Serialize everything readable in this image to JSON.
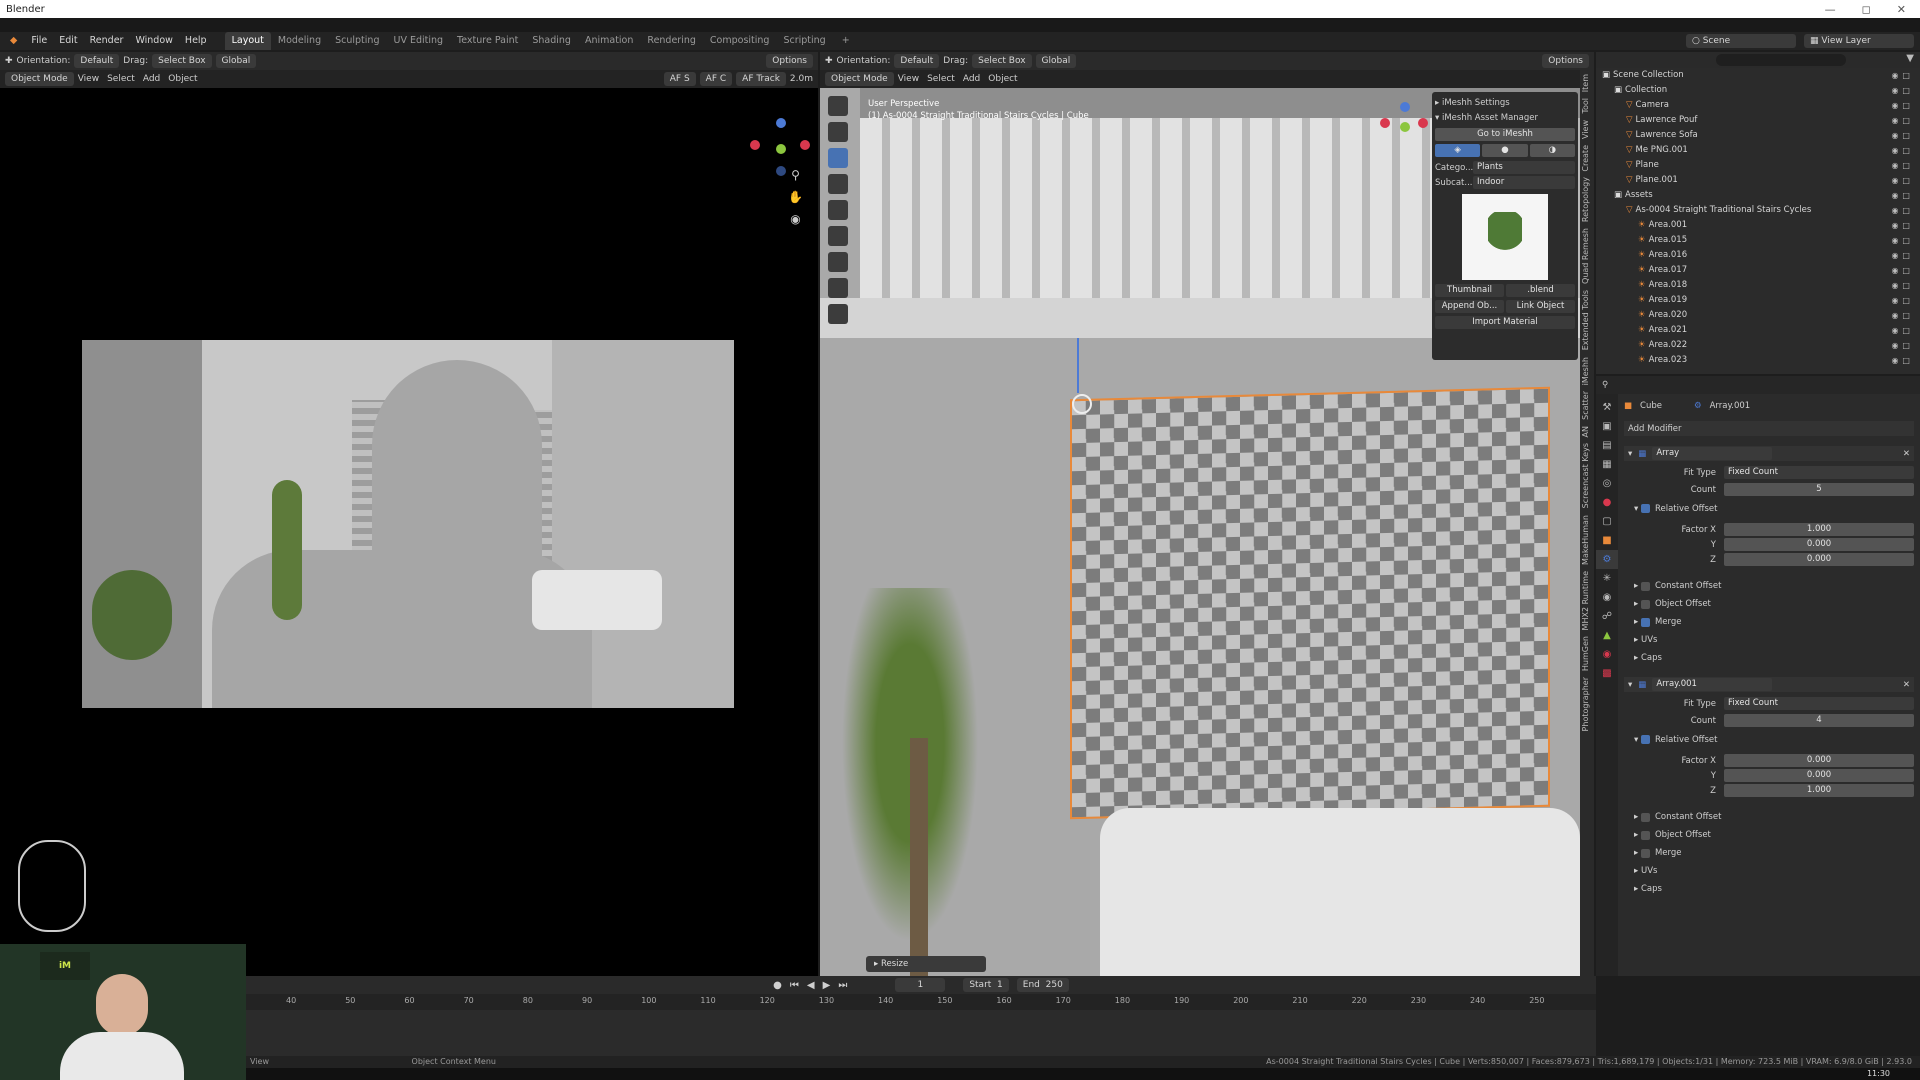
{
  "window": {
    "title": "Blender"
  },
  "menu": [
    "File",
    "Edit",
    "Render",
    "Window",
    "Help"
  ],
  "workspaces": [
    "Layout",
    "Modeling",
    "Sculpting",
    "UV Editing",
    "Texture Paint",
    "Shading",
    "Animation",
    "Rendering",
    "Compositing",
    "Scripting"
  ],
  "active_workspace": "Layout",
  "scene": {
    "name": "Scene",
    "view_layer": "View Layer"
  },
  "left_viewport": {
    "orientation_label": "Orientation:",
    "orientation_value": "Default",
    "drag_label": "Drag:",
    "drag_value": "Select Box",
    "transform": "Global",
    "options": "Options",
    "mode": "Object Mode",
    "menus": [
      "View",
      "Select",
      "Add",
      "Object"
    ],
    "af_labels": [
      "AF S",
      "AF C",
      "AF Track"
    ],
    "distance": "2.0m"
  },
  "right_viewport": {
    "orientation_label": "Orientation:",
    "orientation_value": "Default",
    "drag_label": "Drag:",
    "drag_value": "Select Box",
    "transform": "Global",
    "options": "Options",
    "mode": "Object Mode",
    "menus": [
      "View",
      "Select",
      "Add",
      "Object"
    ],
    "overlay_line1": "User Perspective",
    "overlay_line2": "(1) As-0004 Straight Traditional Stairs Cycles | Cube",
    "operator_panel": "Resize"
  },
  "imeshh": {
    "settings": "iMeshh Settings",
    "asset_manager": "iMeshh Asset Manager",
    "goto": "Go to iMeshh",
    "category_label": "Catego...",
    "category_value": "Plants",
    "subcategory_label": "Subcat...",
    "subcategory_value": "Indoor",
    "thumbnail": "Thumbnail",
    "blend": ".blend",
    "append": "Append Ob...",
    "link": "Link Object",
    "import": "Import Material"
  },
  "side_tabs": [
    "Item",
    "Tool",
    "View",
    "Create",
    "Retopology",
    "Quad Remesh",
    "Extended Tools",
    "iMeshh",
    "Scatter",
    "AN",
    "Screencast Keys",
    "MakeHuman",
    "MHX2 Runtime",
    "HumGen",
    "Photographer"
  ],
  "outliner": {
    "search_placeholder": "",
    "items": [
      {
        "name": "Scene Collection",
        "indent": 0
      },
      {
        "name": "Collection",
        "indent": 1
      },
      {
        "name": "Camera",
        "indent": 2
      },
      {
        "name": "Lawrence Pouf",
        "indent": 2
      },
      {
        "name": "Lawrence Sofa",
        "indent": 2
      },
      {
        "name": "Me PNG.001",
        "indent": 2
      },
      {
        "name": "Plane",
        "indent": 2
      },
      {
        "name": "Plane.001",
        "indent": 2
      },
      {
        "name": "Assets",
        "indent": 1
      },
      {
        "name": "As-0004 Straight Traditional Stairs Cycles",
        "indent": 2
      },
      {
        "name": "Area.001",
        "indent": 3
      },
      {
        "name": "Area.015",
        "indent": 3
      },
      {
        "name": "Area.016",
        "indent": 3
      },
      {
        "name": "Area.017",
        "indent": 3
      },
      {
        "name": "Area.018",
        "indent": 3
      },
      {
        "name": "Area.019",
        "indent": 3
      },
      {
        "name": "Area.020",
        "indent": 3
      },
      {
        "name": "Area.021",
        "indent": 3
      },
      {
        "name": "Area.022",
        "indent": 3
      },
      {
        "name": "Area.023",
        "indent": 3
      }
    ]
  },
  "properties": {
    "object": "Cube",
    "modifier_name_top": "Array.001",
    "add_modifier": "Add Modifier",
    "modifiers": [
      {
        "name": "Array",
        "fit_type_label": "Fit Type",
        "fit_type": "Fixed Count",
        "count_label": "Count",
        "count": "5",
        "relative_offset": "Relative Offset",
        "factor_x_label": "Factor X",
        "x": "1.000",
        "y_label": "Y",
        "y": "0.000",
        "z_label": "Z",
        "z": "0.000",
        "sub": [
          {
            "label": "Constant Offset",
            "checked": false
          },
          {
            "label": "Object Offset",
            "checked": false
          },
          {
            "label": "Merge",
            "checked": true
          },
          {
            "label": "UVs",
            "checked": null
          },
          {
            "label": "Caps",
            "checked": null
          }
        ]
      },
      {
        "name": "Array.001",
        "fit_type_label": "Fit Type",
        "fit_type": "Fixed Count",
        "count_label": "Count",
        "count": "4",
        "relative_offset": "Relative Offset",
        "factor_x_label": "Factor X",
        "x": "0.000",
        "y_label": "Y",
        "y": "0.000",
        "z_label": "Z",
        "z": "1.000",
        "sub": [
          {
            "label": "Constant Offset",
            "checked": false
          },
          {
            "label": "Object Offset",
            "checked": false
          },
          {
            "label": "Merge",
            "checked": false
          },
          {
            "label": "UVs",
            "checked": null
          },
          {
            "label": "Caps",
            "checked": null
          }
        ]
      }
    ]
  },
  "timeline": {
    "current_frame": "1",
    "start_label": "Start",
    "start": "1",
    "end_label": "End",
    "end": "250",
    "ticks": [
      "40",
      "50",
      "60",
      "70",
      "80",
      "90",
      "100",
      "110",
      "120",
      "130",
      "140",
      "150",
      "160",
      "170",
      "180",
      "190",
      "200",
      "210",
      "220",
      "230",
      "240",
      "250"
    ]
  },
  "status": {
    "left": "View",
    "context": "Object Context Menu",
    "right": "As-0004 Straight Traditional Stairs Cycles | Cube | Verts:850,007 | Faces:879,673 | Tris:1,689,179 | Objects:1/31 | Memory: 723.5 MiB | VRAM: 6.9/8.0 GiB | 2.93.0"
  },
  "clock": "11:30",
  "colors": {
    "accent": "#4772b3",
    "selection": "#e8893a",
    "viewport_bg": "#a9a9a9"
  }
}
